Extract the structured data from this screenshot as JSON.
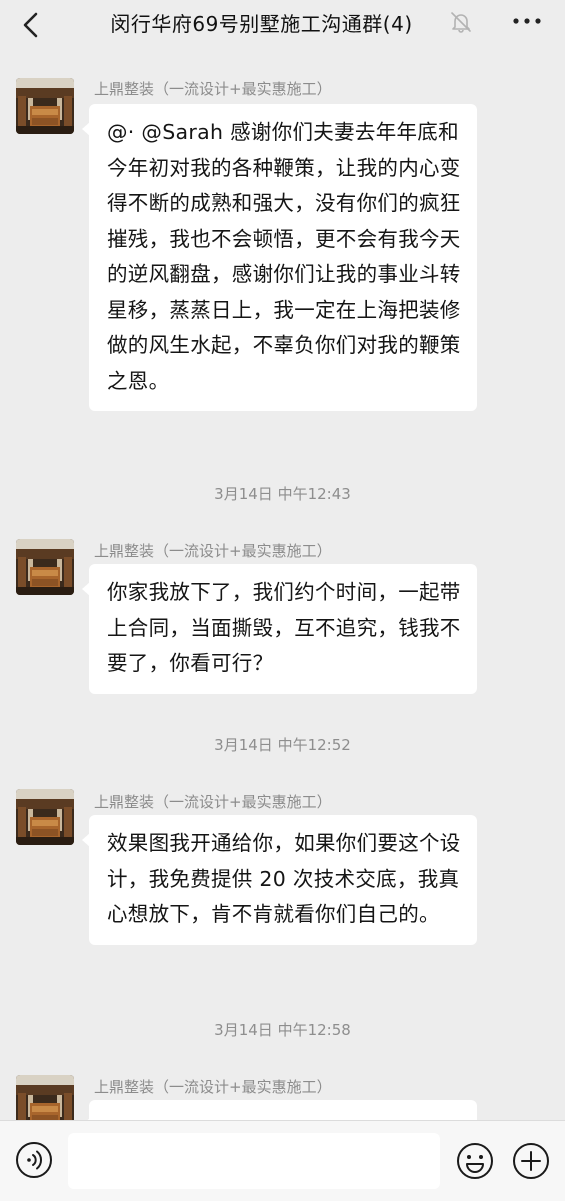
{
  "header": {
    "title": "闵行华府69号别墅施工沟通群(4)",
    "back_icon": "chevron-left",
    "mute_icon": "bell-slash",
    "more_icon": "ellipsis"
  },
  "messages": [
    {
      "sender": "上鼎整装（一流设计+最实惠施工）",
      "text": "@· @Sarah 感谢你们夫妻去年年底和今年初对我的各种鞭策，让我的内心变得不断的成熟和强大，没有你们的疯狂摧残，我也不会顿悟，更不会有我今天的逆风翻盘，感谢你们让我的事业斗转星移，蒸蒸日上，我一定在上海把装修做的风生水起，不辜负你们对我的鞭策之恩。"
    },
    {
      "timestamp": "3月14日 中午12:43",
      "sender": "上鼎整装（一流设计+最实惠施工）",
      "text": "你家我放下了，我们约个时间，一起带上合同，当面撕毁，互不追究，钱我不要了，你看可行？"
    },
    {
      "timestamp": "3月14日 中午12:52",
      "sender": "上鼎整装（一流设计+最实惠施工）",
      "text": "效果图我开通给你，如果你们要这个设计，我免费提供 20 次技术交底，我真心想放下，肯不肯就看你们自己的。"
    },
    {
      "timestamp": "3月14日 中午12:58",
      "sender": "上鼎整装（一流设计+最实惠施工）",
      "text": ""
    }
  ],
  "input_bar": {
    "voice_icon": "voice",
    "input_value": "",
    "emoji_icon": "smiley",
    "plus_icon": "plus-circle"
  },
  "colors": {
    "background": "#ededed",
    "bubble": "#ffffff",
    "sender_text": "#8c8c8c",
    "timestamp_text": "#8e8e8e"
  }
}
